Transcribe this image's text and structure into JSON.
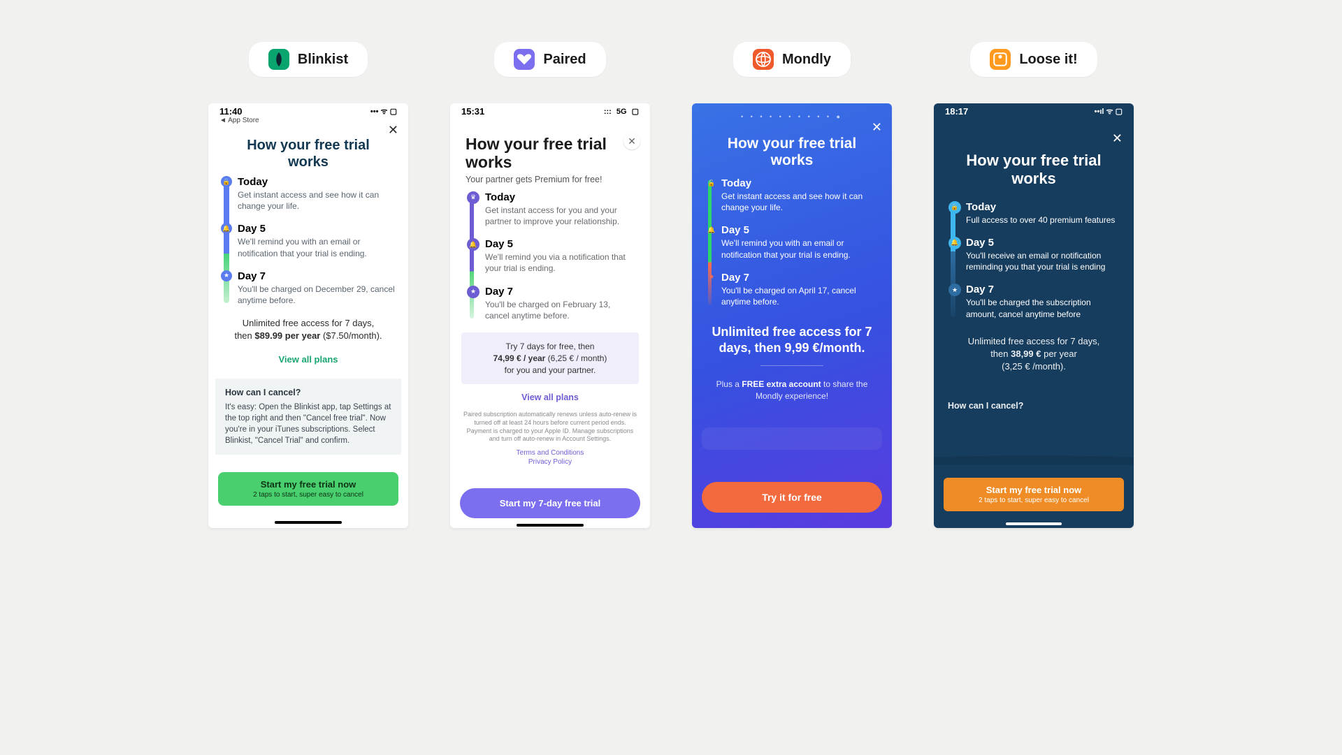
{
  "apps": {
    "blinkist": {
      "name": "Blinkist",
      "time": "11:40",
      "breadcrumb": "◄ App Store",
      "title": "How your free trial works",
      "steps": [
        {
          "h": "Today",
          "p": "Get instant access and see how it can change your life."
        },
        {
          "h": "Day 5",
          "p": "We'll remind you with an email or notification that your trial is ending."
        },
        {
          "h": "Day 7",
          "p": "You'll be charged on December 29, cancel anytime before."
        }
      ],
      "pricing_line1": "Unlimited free access for 7 days,",
      "pricing_line2_pre": "then ",
      "pricing_bold": "$89.99 per year",
      "pricing_line2_post": " ($7.50/month).",
      "plans_link": "View all plans",
      "cancel_h": "How can I cancel?",
      "cancel_p": "It's easy: Open the Blinkist app, tap Settings at the top right and then \"Cancel free trial\". Now you're in your iTunes subscriptions. Select Blinkist, \"Cancel Trial\" and confirm.",
      "cta": "Start my free trial now",
      "cta_sub": "2 taps to start, super easy to cancel"
    },
    "paired": {
      "name": "Paired",
      "time": "15:31",
      "signal": "5G",
      "title": "How your free trial works",
      "subhead": "Your partner gets Premium for free!",
      "steps": [
        {
          "h": "Today",
          "p": "Get instant access for you and your partner to improve your relationship."
        },
        {
          "h": "Day 5",
          "p": "We'll remind you via a notification that your trial is ending."
        },
        {
          "h": "Day 7",
          "p": "You'll be charged on February 13, cancel anytime before."
        }
      ],
      "box_line1": "Try 7 days for free, then",
      "box_bold": "74,99 € / year",
      "box_line2_post": " (6,25 € / month)",
      "box_line3": "for you and your partner.",
      "plans_link": "View all plans",
      "fine": "Paired subscription automatically renews unless auto-renew is turned off at least 24 hours before current period ends. Payment is charged to your Apple ID. Manage subscriptions and turn off auto-renew in Account Settings.",
      "terms": "Terms and Conditions",
      "privacy": "Privacy Policy",
      "cta": "Start my 7-day free trial"
    },
    "mondly": {
      "name": "Mondly",
      "title": "How your free trial works",
      "steps": [
        {
          "h": "Today",
          "p": "Get instant access and see how it can change your life."
        },
        {
          "h": "Day 5",
          "p": "We'll remind you with an email or notification that your trial is ending."
        },
        {
          "h": "Day 7",
          "p": "You'll be charged on April 17, cancel anytime before."
        }
      ],
      "pricing": "Unlimited free access for 7 days, then 9,99 €/month.",
      "extra_pre": "Plus a ",
      "extra_bold": "FREE extra account",
      "extra_post": " to share the Mondly experience!",
      "cta": "Try it for free"
    },
    "looseit": {
      "name": "Loose it!",
      "time": "18:17",
      "title": "How your free trial works",
      "steps": [
        {
          "h": "Today",
          "p": "Full access to over 40 premium features"
        },
        {
          "h": "Day 5",
          "p": "You'll receive an email or notification reminding you that your trial is ending"
        },
        {
          "h": "Day 7",
          "p": "You'll be charged the subscription amount, cancel anytime before"
        }
      ],
      "pricing_l1": "Unlimited free access for 7 days,",
      "pricing_l2_pre": "then ",
      "pricing_bold": "38,99 €",
      "pricing_l2_post": " per year",
      "pricing_l3": "(3,25 € /month).",
      "cancel_h": "How can I cancel?",
      "cta": "Start my free trial now",
      "cta_sub": "2 taps to start, super easy to cancel"
    }
  }
}
